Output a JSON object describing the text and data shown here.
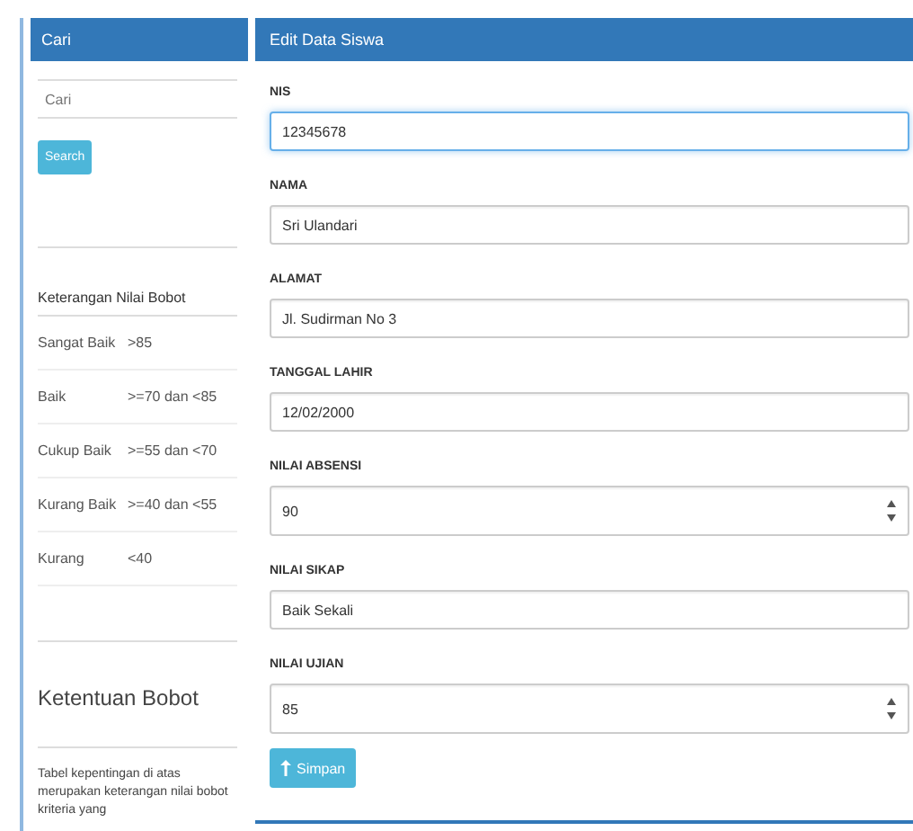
{
  "search_panel": {
    "title": "Cari",
    "placeholder": "Cari",
    "button": "Search"
  },
  "weight_table": {
    "heading": "Keterangan Nilai Bobot",
    "rows": [
      {
        "grade": "Sangat Baik",
        "range": ">85"
      },
      {
        "grade": "Baik",
        "range": ">=70 dan <85"
      },
      {
        "grade": "Cukup Baik",
        "range": ">=55 dan <70"
      },
      {
        "grade": "Kurang Baik",
        "range": ">=40 dan <55"
      },
      {
        "grade": "Kurang",
        "range": "<40"
      }
    ]
  },
  "rules": {
    "title": "Ketentuan Bobot",
    "text": "Tabel kepentingan di atas merupakan keterangan nilai bobot kriteria yang"
  },
  "form": {
    "title": "Edit Data Siswa",
    "fields": [
      {
        "label": "NIS",
        "value": "12345678",
        "kind": "text",
        "focused": true
      },
      {
        "label": "NAMA",
        "value": "Sri Ulandari",
        "kind": "text",
        "focused": false
      },
      {
        "label": "ALAMAT",
        "value": "Jl. Sudirman No 3",
        "kind": "text",
        "focused": false
      },
      {
        "label": "TANGGAL LAHIR",
        "value": "12/02/2000",
        "kind": "text",
        "focused": false
      },
      {
        "label": "NILAI ABSENSI",
        "value": "90",
        "kind": "number",
        "focused": false
      },
      {
        "label": "NILAI SIKAP",
        "value": "Baik Sekali",
        "kind": "text",
        "focused": false
      },
      {
        "label": "NILAI UJIAN",
        "value": "85",
        "kind": "number",
        "focused": false
      }
    ],
    "button": "Simpan"
  }
}
